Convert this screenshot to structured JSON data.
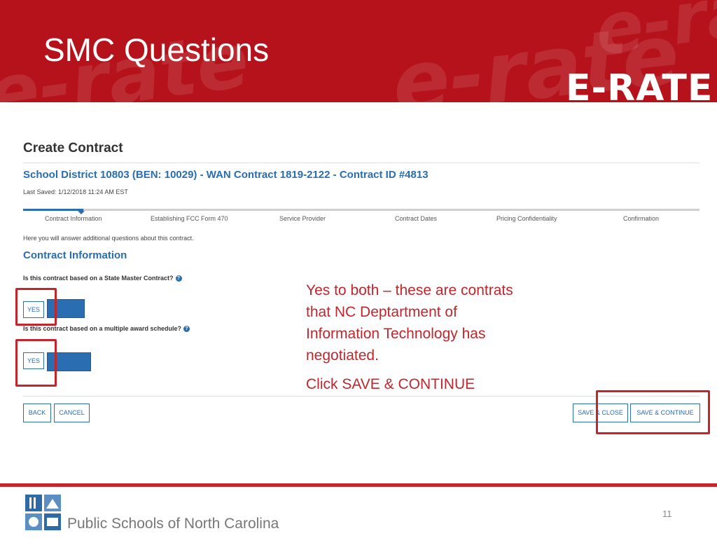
{
  "slide": {
    "title": "SMC Questions",
    "brand": "E-RATE",
    "page_number": "11"
  },
  "banner_decor": [
    "e-rate",
    "e-rate",
    "e-ra"
  ],
  "form": {
    "heading": "Create Contract",
    "subheading": "School District 10803 (BEN: 10029) - WAN Contract 1819-2122 - Contract ID #4813",
    "last_saved": "Last Saved: 1/12/2018 11:24 AM EST",
    "steps": [
      "Contract Information",
      "Establishing FCC Form 470",
      "Service Provider",
      "Contract Dates",
      "Pricing Confidentiality",
      "Confirmation"
    ],
    "intro": "Here you will answer additional questions about this contract.",
    "section_title": "Contract Information",
    "q1": "Is this contract based on a State Master Contract?",
    "q2": "Is this contract based on a multiple award schedule?",
    "yes_label": "YES",
    "back_label": "BACK",
    "cancel_label": "CANCEL",
    "save_close_label": "SAVE & CLOSE",
    "save_continue_label": "SAVE & CONTINUE"
  },
  "annotation": {
    "lines": [
      "Yes to both – these are contrats",
      "that NC Deptartment of",
      "Information Technology has",
      "negotiated."
    ],
    "action": "Click SAVE & CONTINUE"
  },
  "footer": {
    "org": "Public Schools of North Carolina"
  },
  "colors": {
    "banner": "#b5121b",
    "accent_blue": "#2a6db0",
    "highlight_red": "#c0262c"
  }
}
